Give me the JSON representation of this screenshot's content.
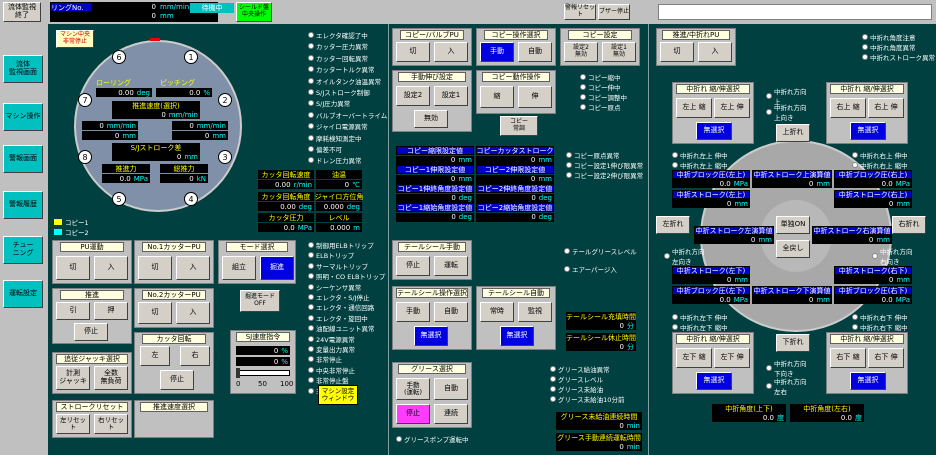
{
  "top": {
    "system_end": "流体監視\n終了",
    "ring_label": "リングNo.",
    "ring_v1": "0",
    "ring_v2": "0",
    "unit_mm_min": "mm/min",
    "unit_mm": "mm",
    "status": "待機中",
    "shield": "シールド盤\n中央操作",
    "alarm_reset": "警報リセット",
    "buzzer_stop": "ブザー停止"
  },
  "side": [
    "流体\n監視画面",
    "マシン操作",
    "警報画面",
    "警報履歴",
    "チュー\nニング",
    "運転設定"
  ],
  "left": {
    "emerg": "マシン中央\n非常停止",
    "nums": [
      "6",
      "1",
      "7",
      "2",
      "8",
      "3",
      "5",
      "4"
    ],
    "row1": [
      "ローリング",
      "ピッチング"
    ],
    "row1v": [
      "0.00",
      "deg",
      "0.0",
      "%"
    ],
    "speed": "推進速度(選択)",
    "speed_v": "0",
    "sj": "S/Jストローク差",
    "sj_v": "0",
    "pushforce": "推進力",
    "total": "総推力",
    "pf_v": "0.0",
    "pf_u": "MPa",
    "tot_v": "0",
    "tot_u": "kN",
    "lr": [
      "0",
      "0",
      "0",
      "0"
    ],
    "lr_u": "mm/min",
    "lr_u2": "mm",
    "copy1": "コピー1",
    "copy2": "コピー2"
  },
  "alarms1": [
    "エレクタ確認了中",
    "カッター圧力異常",
    "カッター回転異常",
    "カッタートルク異常",
    "オイルタンク油温異常",
    "S/Jストローク制御",
    "S/J圧力異常",
    "バルブオーバートライム",
    "ジャイロ電源異常",
    "摩耗検知測定中",
    "偏差不可",
    "ドレン圧力異常"
  ],
  "readouts": {
    "t1": "カッタ回転速度",
    "t2": "油温",
    "v1": "0.00",
    "u1": "r/min",
    "v2": "0",
    "u2": "℃",
    "t3": "カッタ回転角度",
    "t4": "ジャイロ方位角",
    "v3": "0.00",
    "u3": "deg",
    "v4": "0.000",
    "u4": "deg",
    "t5": "カッタ圧力",
    "t6": "レベル",
    "v5": "0.0",
    "u5": "MPa",
    "v6": "0.000",
    "u6": "m"
  },
  "alarms2": [
    "制御用ELBトリップ",
    "ELBトリップ",
    "サーマルトリップ",
    "照明・CO ELBトリップ",
    "シーケンサ異常",
    "エレクタ・S/J停止",
    "エレクタ・通信回路",
    "エレクタ・旋回中",
    "油配線ユニット異常",
    "24V電源異常",
    "変量出力異常",
    "非常停止",
    "中央非常停止",
    "非常停止盤",
    "非常停止操作"
  ],
  "pu": {
    "title": "PU運動",
    "off": "切",
    "on": "入"
  },
  "cut1": {
    "title": "No.1カッターPU",
    "off": "切",
    "on": "入"
  },
  "cut2": {
    "title": "No.2カッターPU",
    "off": "切",
    "on": "入"
  },
  "mode": {
    "title": "モード選択",
    "a": "組立",
    "b": "掘進",
    "sub": "掘進モード\nOFF"
  },
  "push": {
    "title": "推進",
    "a": "引",
    "b": "押",
    "stop": "停止"
  },
  "rot": {
    "title": "カッタ回転",
    "l": "左",
    "r": "右",
    "stop": "停止"
  },
  "sj": {
    "title": "SJ速度指令",
    "v1": "0",
    "v2": "0",
    "u": "%",
    "scale": [
      "0",
      "50",
      "100"
    ]
  },
  "jack": {
    "title": "追従ジャッキ選択",
    "a": "計測\nジャッキ",
    "b": "全数\n無負荷"
  },
  "reset": {
    "title": "ストロークリセット",
    "l": "左リセット",
    "r": "右リセット"
  },
  "pspeed": {
    "title": "推進速度選択"
  },
  "mset": "マシン設定\nウィンドウ",
  "copyvalve": {
    "title": "コピー/バルブPU",
    "off": "切",
    "on": "入"
  },
  "copyop": {
    "title": "コピー操作選択",
    "a": "手動",
    "b": "自動"
  },
  "copyset": {
    "title": "コピー設定",
    "a": "設定2\n無効",
    "b": "設定1\n無効"
  },
  "copyhand": {
    "title": "手動伸び設定",
    "a": "設定2",
    "b": "設定1",
    "c": "無効"
  },
  "copymove": {
    "title": "コピー動作操作",
    "a": "縮",
    "b": "伸",
    "c": "コピー\n常調"
  },
  "copylamps": [
    "コピー縮中",
    "コピー伸中",
    "コピー調整中",
    "コピー原点"
  ],
  "copytable": [
    [
      "コピー縮限設定値",
      "コピーカッタストローク"
    ],
    [
      "0",
      "mm",
      "0",
      "mm"
    ],
    [
      "コピー1伸限設定値",
      "コピー2伸限設定値"
    ],
    [
      "0",
      "mm",
      "0",
      "mm"
    ],
    [
      "コピー1伸終角度設定値",
      "コピー2伸終角度設定値"
    ],
    [
      "0",
      "deg",
      "0",
      "deg"
    ],
    [
      "コピー1縮始角度設定値",
      "コピー2縮始角度設定値"
    ],
    [
      "0",
      "deg",
      "0",
      "deg"
    ]
  ],
  "copyerr": [
    "コピー原点異常",
    "コピー設定1伸び限異常",
    "コピー設定2伸び限異常"
  ],
  "tail": {
    "title": "テールシール手動",
    "a": "停止",
    "b": "運転",
    "l1": "テールグリースレベル",
    "l2": "エアーパージ入"
  },
  "tailop": {
    "title": "テールシール操作選択",
    "a": "手動",
    "b": "自動",
    "c": "無選択"
  },
  "tailauto": {
    "title": "テールシール自動",
    "a": "常時",
    "b": "監視",
    "c": "無選択"
  },
  "tailtime": {
    "t1": "テールシール充填時間",
    "v1": "0",
    "u": "分",
    "t2": "テールシール休止時間",
    "v2": "0"
  },
  "grease": {
    "title": "グリース選択",
    "a": "手動\n(運転)",
    "b": "自動",
    "c": "停止",
    "d": "連続",
    "pump": "グリースポンプ運転中"
  },
  "greaselamps": [
    "グリース給油異常",
    "グリースレベル",
    "グリース未給油",
    "グリース未給油10分前"
  ],
  "greasetime": {
    "t1": "グリース未給油連続時間",
    "v1": "0",
    "u1": "min",
    "t2": "グリース手動連続運転時間",
    "v2": "0",
    "u2": "min"
  },
  "mid": {
    "title": "推進/中折れPU",
    "off": "切",
    "on": "入",
    "warn": [
      "中折れ角度注意",
      "中折れ角度異常",
      "中折れストローク異常"
    ]
  },
  "chu": {
    "ul": "中折れ 縮/伸選択",
    "ula": "左上 縮",
    "ulb": "左上 伸",
    "none": "無選択",
    "ur": "中折れ 縮/伸選択",
    "ura": "右上 縮",
    "urb": "右上 伸",
    "dl": "中折れ 縮/伸選択",
    "dla": "左下 縮",
    "dlb": "左下 伸",
    "dr": "中折れ 縮/伸選択",
    "dra": "右下 縮",
    "drb": "右下 伸",
    "up": "上折れ",
    "down": "下折れ",
    "left": "左折れ",
    "right": "右折れ",
    "single": "単独ON",
    "all": "全戻し"
  },
  "chudir": {
    "up1": "中折れ方向\n上",
    "up2": "中折れ方向\n上向き",
    "dn1": "中折れ方向\n下向き",
    "dn2": "中折れ方向\n左右",
    "lf": "中折れ方向\n左向き",
    "rt": "中折れ方向\n右向き"
  },
  "chulamps": [
    "中折れ左上 伸中",
    "中折れ左上 縮中",
    "中折れ右上 伸中",
    "中折れ右上 縮中",
    "中折れ左下 伸中",
    "中折れ左下 縮中",
    "中折れ右下 伸中",
    "中折れ右下 縮中"
  ],
  "chuvals": {
    "a": "中折ブロック圧(左上)",
    "a2": "中折ストローク上演算値",
    "a3": "中折ブロック圧(右上)",
    "b": "中折ストローク(左上)",
    "b2": "中折ストローク(右上)",
    "c": "中折ストローク左演算値",
    "c2": "中折ストローク右演算値",
    "d": "中折ストローク(左下)",
    "d2": "中折ストローク(右下)",
    "e": "中折ブロック圧(左下)",
    "e2": "中折ストローク下演算値",
    "e3": "中折ブロック圧(右下)",
    "v0": "0.0",
    "mpa": "MPa",
    "mm": "mm",
    "zero": "0"
  },
  "angle": {
    "t1": "中折角度(上下)",
    "t2": "中折角度(左右)",
    "v1": "0.0",
    "v2": "0.0",
    "u": "度"
  }
}
